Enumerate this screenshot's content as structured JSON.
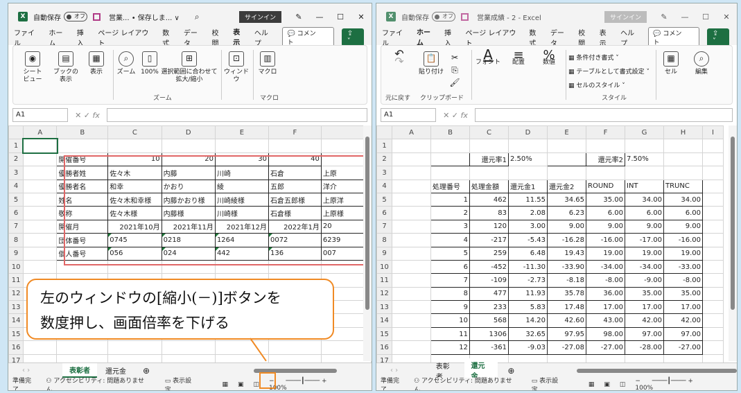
{
  "left": {
    "autosave": "自動保存",
    "toggle": "オフ",
    "title": "営業... • 保存しま... ∨",
    "signin": "サインイン",
    "menu": [
      "ファイル",
      "ホーム",
      "挿入",
      "ページ レイアウト",
      "数式",
      "データ",
      "校閲",
      "表示",
      "ヘルプ"
    ],
    "active_menu": "表示",
    "comment": "コメント",
    "ribbon": {
      "sheet_view": "シート\nビュー",
      "book_view": "ブックの\n表示",
      "show": "表示",
      "zoom": "ズーム",
      "zoom100": "100%",
      "zoom_sel": "選択範囲に合わせて\n拡大/縮小",
      "window": "ウィンドウ",
      "macro": "マクロ",
      "grp_zoom": "ズーム",
      "grp_macro": "マクロ"
    },
    "cell": "A1",
    "cols": [
      "A",
      "B",
      "C",
      "D",
      "E",
      "F"
    ],
    "rows": [
      [
        "",
        "",
        "",
        "",
        "",
        ""
      ],
      [
        "",
        "開催番号",
        "10",
        "20",
        "30",
        "40"
      ],
      [
        "",
        "優勝者姓",
        "佐々木",
        "内藤",
        "川崎",
        "石倉",
        "上原"
      ],
      [
        "",
        "優勝者名",
        "和幸",
        "かおり",
        "綾",
        "五郎",
        "洋介"
      ],
      [
        "",
        "姓名",
        "佐々木和幸様",
        "内藤かおり様",
        "川崎綾様",
        "石倉五郎様",
        "上原洋"
      ],
      [
        "",
        "敬称",
        "佐々木様",
        "内藤様",
        "川崎様",
        "石倉様",
        "上原様"
      ],
      [
        "",
        "開催月",
        "2021年10月",
        "2021年11月",
        "2021年12月",
        "2022年1月",
        "20"
      ],
      [
        "",
        "団体番号",
        "0745",
        "0218",
        "1264",
        "0072",
        "6239"
      ],
      [
        "",
        "個人番号",
        "056",
        "024",
        "442",
        "136",
        "007"
      ],
      [
        "",
        "",
        "",
        "",
        "",
        "",
        ""
      ],
      [
        "",
        "",
        "",
        "",
        "",
        "",
        ""
      ],
      [
        "",
        "",
        "",
        "",
        "",
        "",
        ""
      ],
      [
        "",
        "",
        "",
        "",
        "",
        "",
        ""
      ],
      [
        "",
        "",
        "",
        "",
        "",
        "",
        ""
      ],
      [
        "",
        "",
        "",
        "",
        "",
        "",
        ""
      ],
      [
        "",
        "",
        "",
        "",
        "",
        "",
        ""
      ],
      [
        "",
        "",
        "",
        "",
        "",
        "",
        ""
      ]
    ],
    "tabs": [
      "表彰者",
      "還元金"
    ],
    "status": [
      "準備完了",
      "アクセシビリティ: 問題ありません",
      "表示設定"
    ],
    "zoom": "100%"
  },
  "right": {
    "autosave": "自動保存",
    "toggle": "オフ",
    "title": "営業成績 - 2 - Excel",
    "signin": "サインイン",
    "menu": [
      "ファイル",
      "ホーム",
      "挿入",
      "ページ レイアウト",
      "数式",
      "データ",
      "校閲",
      "表示",
      "ヘルプ"
    ],
    "active_menu": "ホーム",
    "comment": "コメント",
    "ribbon": {
      "undo": "元に戻す",
      "paste": "貼り付け",
      "clip": "クリップボード",
      "font": "フォント",
      "align": "配置",
      "num": "数値",
      "cond": "条件付き書式",
      "table": "テーブルとして書式設定",
      "style": "セルのスタイル",
      "grp_style": "スタイル",
      "cell": "セル",
      "edit": "編集"
    },
    "cell": "A1",
    "cols": [
      "A",
      "B",
      "C",
      "D",
      "E",
      "F",
      "G",
      "H",
      "I"
    ],
    "rate1_label": "還元率1",
    "rate1": "2.50%",
    "rate2_label": "還元率2",
    "rate2": "7.50%",
    "headers": [
      "処理番号",
      "処理金額",
      "還元金1",
      "還元金2",
      "ROUND",
      "INT",
      "TRUNC"
    ],
    "data": [
      [
        "1",
        "462",
        "11.55",
        "34.65",
        "35.00",
        "34.00",
        "34.00"
      ],
      [
        "2",
        "83",
        "2.08",
        "6.23",
        "6.00",
        "6.00",
        "6.00"
      ],
      [
        "3",
        "120",
        "3.00",
        "9.00",
        "9.00",
        "9.00",
        "9.00"
      ],
      [
        "4",
        "-217",
        "-5.43",
        "-16.28",
        "-16.00",
        "-17.00",
        "-16.00"
      ],
      [
        "5",
        "259",
        "6.48",
        "19.43",
        "19.00",
        "19.00",
        "19.00"
      ],
      [
        "6",
        "-452",
        "-11.30",
        "-33.90",
        "-34.00",
        "-34.00",
        "-33.00"
      ],
      [
        "7",
        "-109",
        "-2.73",
        "-8.18",
        "-8.00",
        "-9.00",
        "-8.00"
      ],
      [
        "8",
        "477",
        "11.93",
        "35.78",
        "36.00",
        "35.00",
        "35.00"
      ],
      [
        "9",
        "233",
        "5.83",
        "17.48",
        "17.00",
        "17.00",
        "17.00"
      ],
      [
        "10",
        "568",
        "14.20",
        "42.60",
        "43.00",
        "42.00",
        "42.00"
      ],
      [
        "11",
        "1306",
        "32.65",
        "97.95",
        "98.00",
        "97.00",
        "97.00"
      ],
      [
        "12",
        "-361",
        "-9.03",
        "-27.08",
        "-27.00",
        "-28.00",
        "-27.00"
      ]
    ],
    "tabs": [
      "表彰者",
      "還元金"
    ],
    "status": [
      "準備完了",
      "アクセシビリティ: 問題ありません",
      "表示設定"
    ],
    "zoom": "100%"
  },
  "callout": "左のウィンドウの[縮小(－)]ボタンを\n数度押し、画面倍率を下げる"
}
